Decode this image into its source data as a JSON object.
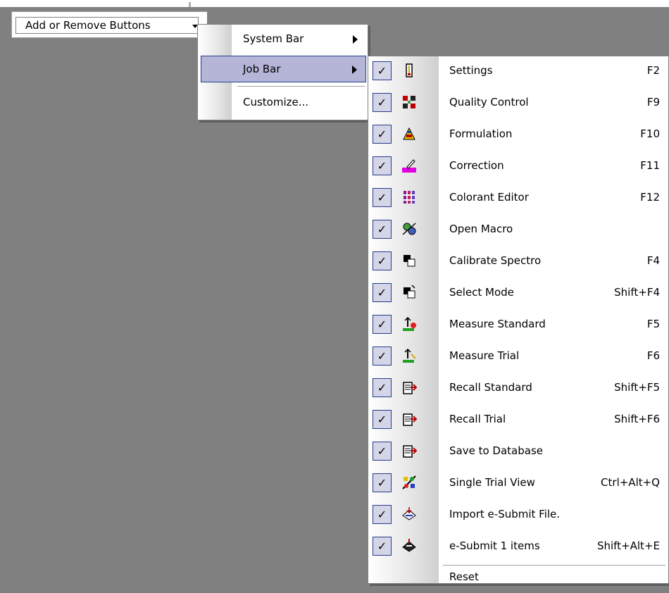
{
  "toolbar": {
    "add_remove_label": "Add or Remove Buttons"
  },
  "menu1": {
    "items": [
      {
        "label": "System Bar",
        "has_submenu": true
      },
      {
        "label": "Job Bar",
        "has_submenu": true,
        "highlighted": true
      },
      {
        "label": "Customize..."
      }
    ]
  },
  "menu2": {
    "items": [
      {
        "label": "Settings",
        "shortcut": "F2",
        "checked": true,
        "icon": "settings-icon"
      },
      {
        "label": "Quality Control",
        "shortcut": "F9",
        "checked": true,
        "icon": "quality-control-icon"
      },
      {
        "label": "Formulation",
        "shortcut": "F10",
        "checked": true,
        "icon": "formulation-icon"
      },
      {
        "label": "Correction",
        "shortcut": "F11",
        "checked": true,
        "icon": "correction-icon"
      },
      {
        "label": "Colorant Editor",
        "shortcut": "F12",
        "checked": true,
        "icon": "colorant-editor-icon"
      },
      {
        "label": "Open Macro",
        "shortcut": "",
        "checked": true,
        "icon": "open-macro-icon"
      },
      {
        "label": "Calibrate Spectro",
        "shortcut": "F4",
        "checked": true,
        "icon": "calibrate-spectro-icon"
      },
      {
        "label": "Select Mode",
        "shortcut": "Shift+F4",
        "checked": true,
        "icon": "select-mode-icon"
      },
      {
        "label": "Measure Standard",
        "shortcut": "F5",
        "checked": true,
        "icon": "measure-standard-icon"
      },
      {
        "label": "Measure Trial",
        "shortcut": "F6",
        "checked": true,
        "icon": "measure-trial-icon"
      },
      {
        "label": "Recall Standard",
        "shortcut": "Shift+F5",
        "checked": true,
        "icon": "recall-standard-icon"
      },
      {
        "label": "Recall Trial",
        "shortcut": "Shift+F6",
        "checked": true,
        "icon": "recall-trial-icon"
      },
      {
        "label": "Save to Database",
        "shortcut": "",
        "checked": true,
        "icon": "save-database-icon"
      },
      {
        "label": "Single Trial View",
        "shortcut": "Ctrl+Alt+Q",
        "checked": true,
        "icon": "single-trial-view-icon"
      },
      {
        "label": "Import e-Submit File.",
        "shortcut": "",
        "checked": true,
        "icon": "import-esubmit-icon"
      },
      {
        "label": "e-Submit 1 items",
        "shortcut": "Shift+Alt+E",
        "checked": true,
        "icon": "esubmit-icon"
      }
    ],
    "reset_label": "Reset"
  },
  "check_glyph": "✓",
  "colors": {
    "background": "#808080",
    "highlight": "#b5b5d8",
    "highlight_border": "#243c87"
  }
}
